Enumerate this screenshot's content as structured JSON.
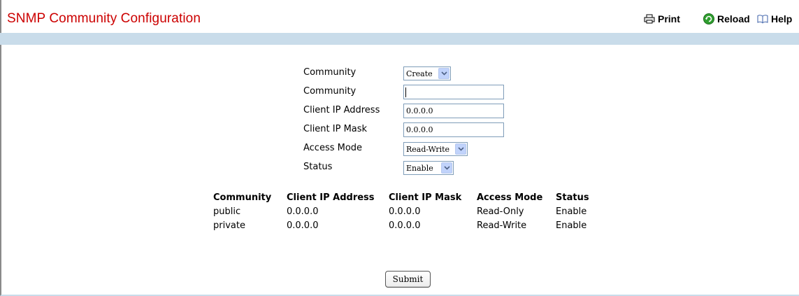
{
  "header": {
    "title": "SNMP Community Configuration",
    "print_label": "Print",
    "reload_label": "Reload",
    "help_label": "Help"
  },
  "form": {
    "community_select": {
      "label": "Community",
      "value": "Create"
    },
    "community_input": {
      "label": "Community",
      "value": ""
    },
    "client_ip_address": {
      "label": "Client IP Address",
      "value": "0.0.0.0"
    },
    "client_ip_mask": {
      "label": "Client IP Mask",
      "value": "0.0.0.0"
    },
    "access_mode": {
      "label": "Access Mode",
      "value": "Read-Write"
    },
    "status": {
      "label": "Status",
      "value": "Enable"
    }
  },
  "table": {
    "headers": [
      "Community",
      "Client IP Address",
      "Client IP Mask",
      "Access Mode",
      "Status"
    ],
    "rows": [
      [
        "public",
        "0.0.0.0",
        "0.0.0.0",
        "Read-Only",
        "Enable"
      ],
      [
        "private",
        "0.0.0.0",
        "0.0.0.0",
        "Read-Write",
        "Enable"
      ]
    ]
  },
  "submit_label": "Submit",
  "colors": {
    "title": "#cc0000",
    "band": "#c9dcea",
    "select_arrow": "#c1d3fb",
    "input_border": "#7f9db9"
  }
}
